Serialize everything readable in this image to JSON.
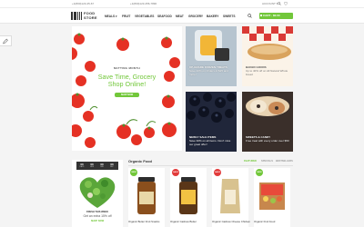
{
  "topbar": {
    "phone_1": "+1(800)123-45-67",
    "phone_2": "+1(800)123-456-7890",
    "account": "ACCOUNT ▾"
  },
  "header": {
    "logo_line_1": "FOOD",
    "logo_line_2": "STORE",
    "nav": [
      "MEALS ▾",
      "FRUIT",
      "VEGETABLES",
      "SEAFOOD",
      "MEAT",
      "GROCERY",
      "BAKERY",
      "SWEETS"
    ],
    "cart_label": "CART · $0.00"
  },
  "hero": {
    "kicker": "NETTING MONTH",
    "title_line_1": "Save Time, Grocery",
    "title_line_2": "Shop Online!",
    "button": "SHOP NOW",
    "slides": 3,
    "active_slide": 1
  },
  "tiles": [
    {
      "label": "UP-GRADE FROZEN TREATS",
      "subtitle": "Save 20% on Orders of $25 and more!"
    },
    {
      "label": "BAKED GOODS",
      "subtitle": "Up to 40% off on All Natural Whole bread"
    },
    {
      "label": "NEWLY SALE ITEMS",
      "subtitle": "Save 30% on all items. Don't miss our great offer!"
    },
    {
      "label": "SWEETS & CANDY",
      "subtitle": "Free treat with every order over $50"
    }
  ],
  "promo": {
    "countdown": [
      {
        "value": "00",
        "unit": "DAYS"
      },
      {
        "value": "00",
        "unit": "HRS"
      },
      {
        "value": "00",
        "unit": "MIN"
      },
      {
        "value": "00",
        "unit": "SEC"
      }
    ],
    "title": "FRESH THIS WEEK",
    "subtitle": "Get an extra 15% off",
    "link": "SHOP NOW"
  },
  "products_section": {
    "title": "Organic Food",
    "tabs": [
      "FEATURED",
      "SPECIALS",
      "BESTSELLERS"
    ],
    "active_tab": 0,
    "items": [
      {
        "name": "Organic Butter Fruit Snacks",
        "badge": "NEW",
        "badge_color": "#72c73a"
      },
      {
        "name": "Organic Cashew Butter",
        "badge": "SALE",
        "badge_color": "#e23b3b"
      },
      {
        "name": "Organic Cashew Cheese Chicken",
        "badge": "SALE",
        "badge_color": "#e23b3b"
      },
      {
        "name": "Organic Fruit Food",
        "badge": "NEW",
        "badge_color": "#72c73a"
      }
    ]
  },
  "colors": {
    "accent": "#72c73a",
    "sale": "#e23b3b",
    "dark": "#333333"
  },
  "icons": [
    "logo-barcode-icon",
    "search-icon",
    "cart-icon",
    "pencil-icon"
  ]
}
